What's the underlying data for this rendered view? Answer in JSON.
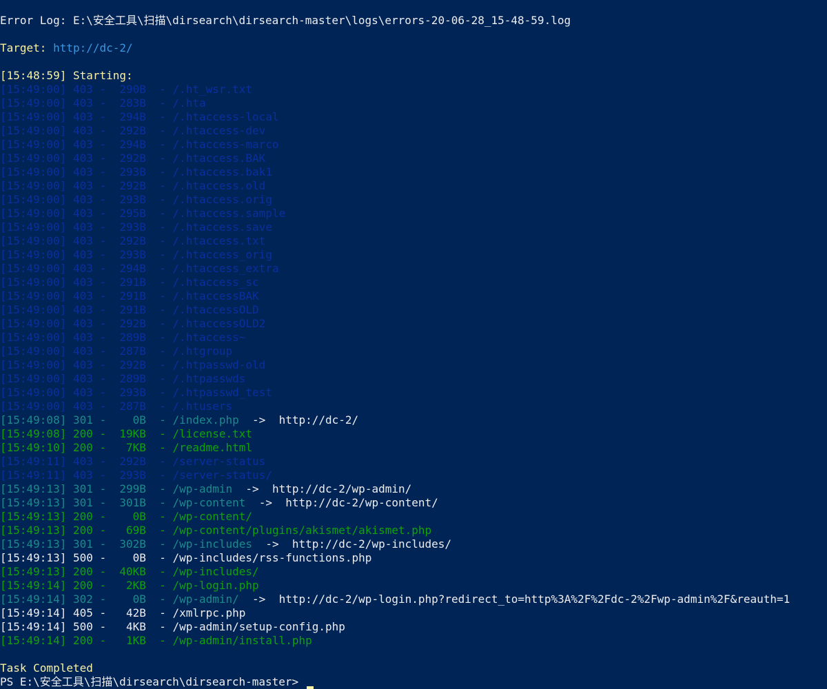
{
  "header": {
    "error_log": "Error Log: E:\\安全工具\\扫描\\dirsearch\\dirsearch-master\\logs\\errors-20-06-28_15-48-59.log",
    "target_label": "Target: ",
    "target_url": "http://dc-2/",
    "starting": "[15:48:59] Starting:"
  },
  "colors": {
    "background": "#012456",
    "403": "#0a2f9e",
    "301": "#1c8a8a",
    "302": "#1c8a8a",
    "200": "#11a10e",
    "500": "#eeedf0",
    "405": "#eeedf0"
  },
  "results": [
    {
      "time": "15:49:00",
      "code": "403",
      "size": "290B",
      "path": "/.ht_wsr.txt",
      "redirect": ""
    },
    {
      "time": "15:49:00",
      "code": "403",
      "size": "283B",
      "path": "/.hta",
      "redirect": ""
    },
    {
      "time": "15:49:00",
      "code": "403",
      "size": "294B",
      "path": "/.htaccess-local",
      "redirect": ""
    },
    {
      "time": "15:49:00",
      "code": "403",
      "size": "292B",
      "path": "/.htaccess-dev",
      "redirect": ""
    },
    {
      "time": "15:49:00",
      "code": "403",
      "size": "294B",
      "path": "/.htaccess-marco",
      "redirect": ""
    },
    {
      "time": "15:49:00",
      "code": "403",
      "size": "292B",
      "path": "/.htaccess.BAK",
      "redirect": ""
    },
    {
      "time": "15:49:00",
      "code": "403",
      "size": "293B",
      "path": "/.htaccess.bak1",
      "redirect": ""
    },
    {
      "time": "15:49:00",
      "code": "403",
      "size": "292B",
      "path": "/.htaccess.old",
      "redirect": ""
    },
    {
      "time": "15:49:00",
      "code": "403",
      "size": "293B",
      "path": "/.htaccess.orig",
      "redirect": ""
    },
    {
      "time": "15:49:00",
      "code": "403",
      "size": "295B",
      "path": "/.htaccess.sample",
      "redirect": ""
    },
    {
      "time": "15:49:00",
      "code": "403",
      "size": "293B",
      "path": "/.htaccess.save",
      "redirect": ""
    },
    {
      "time": "15:49:00",
      "code": "403",
      "size": "292B",
      "path": "/.htaccess.txt",
      "redirect": ""
    },
    {
      "time": "15:49:00",
      "code": "403",
      "size": "293B",
      "path": "/.htaccess_orig",
      "redirect": ""
    },
    {
      "time": "15:49:00",
      "code": "403",
      "size": "294B",
      "path": "/.htaccess_extra",
      "redirect": ""
    },
    {
      "time": "15:49:00",
      "code": "403",
      "size": "291B",
      "path": "/.htaccess_sc",
      "redirect": ""
    },
    {
      "time": "15:49:00",
      "code": "403",
      "size": "291B",
      "path": "/.htaccessBAK",
      "redirect": ""
    },
    {
      "time": "15:49:00",
      "code": "403",
      "size": "291B",
      "path": "/.htaccessOLD",
      "redirect": ""
    },
    {
      "time": "15:49:00",
      "code": "403",
      "size": "292B",
      "path": "/.htaccessOLD2",
      "redirect": ""
    },
    {
      "time": "15:49:00",
      "code": "403",
      "size": "289B",
      "path": "/.htaccess~",
      "redirect": ""
    },
    {
      "time": "15:49:00",
      "code": "403",
      "size": "287B",
      "path": "/.htgroup",
      "redirect": ""
    },
    {
      "time": "15:49:00",
      "code": "403",
      "size": "292B",
      "path": "/.htpasswd-old",
      "redirect": ""
    },
    {
      "time": "15:49:00",
      "code": "403",
      "size": "289B",
      "path": "/.htpasswds",
      "redirect": ""
    },
    {
      "time": "15:49:00",
      "code": "403",
      "size": "293B",
      "path": "/.htpasswd_test",
      "redirect": ""
    },
    {
      "time": "15:49:00",
      "code": "403",
      "size": "287B",
      "path": "/.htusers",
      "redirect": ""
    },
    {
      "time": "15:49:08",
      "code": "301",
      "size": "0B",
      "path": "/index.php",
      "redirect": "http://dc-2/"
    },
    {
      "time": "15:49:08",
      "code": "200",
      "size": "19KB",
      "path": "/license.txt",
      "redirect": ""
    },
    {
      "time": "15:49:10",
      "code": "200",
      "size": "7KB",
      "path": "/readme.html",
      "redirect": ""
    },
    {
      "time": "15:49:11",
      "code": "403",
      "size": "292B",
      "path": "/server-status",
      "redirect": ""
    },
    {
      "time": "15:49:11",
      "code": "403",
      "size": "293B",
      "path": "/server-status/",
      "redirect": ""
    },
    {
      "time": "15:49:13",
      "code": "301",
      "size": "299B",
      "path": "/wp-admin",
      "redirect": "http://dc-2/wp-admin/"
    },
    {
      "time": "15:49:13",
      "code": "301",
      "size": "301B",
      "path": "/wp-content",
      "redirect": "http://dc-2/wp-content/"
    },
    {
      "time": "15:49:13",
      "code": "200",
      "size": "0B",
      "path": "/wp-content/",
      "redirect": ""
    },
    {
      "time": "15:49:13",
      "code": "200",
      "size": "69B",
      "path": "/wp-content/plugins/akismet/akismet.php",
      "redirect": ""
    },
    {
      "time": "15:49:13",
      "code": "301",
      "size": "302B",
      "path": "/wp-includes",
      "redirect": "http://dc-2/wp-includes/"
    },
    {
      "time": "15:49:13",
      "code": "500",
      "size": "0B",
      "path": "/wp-includes/rss-functions.php",
      "redirect": ""
    },
    {
      "time": "15:49:13",
      "code": "200",
      "size": "40KB",
      "path": "/wp-includes/",
      "redirect": ""
    },
    {
      "time": "15:49:14",
      "code": "200",
      "size": "2KB",
      "path": "/wp-login.php",
      "redirect": ""
    },
    {
      "time": "15:49:14",
      "code": "302",
      "size": "0B",
      "path": "/wp-admin/",
      "redirect": "http://dc-2/wp-login.php?redirect_to=http%3A%2F%2Fdc-2%2Fwp-admin%2F&reauth=1"
    },
    {
      "time": "15:49:14",
      "code": "405",
      "size": "42B",
      "path": "/xmlrpc.php",
      "redirect": ""
    },
    {
      "time": "15:49:14",
      "code": "500",
      "size": "4KB",
      "path": "/wp-admin/setup-config.php",
      "redirect": ""
    },
    {
      "time": "15:49:14",
      "code": "200",
      "size": "1KB",
      "path": "/wp-admin/install.php",
      "redirect": ""
    }
  ],
  "footer": {
    "task_completed": "Task Completed",
    "prompt": "PS E:\\安全工具\\扫描\\dirsearch\\dirsearch-master> "
  }
}
